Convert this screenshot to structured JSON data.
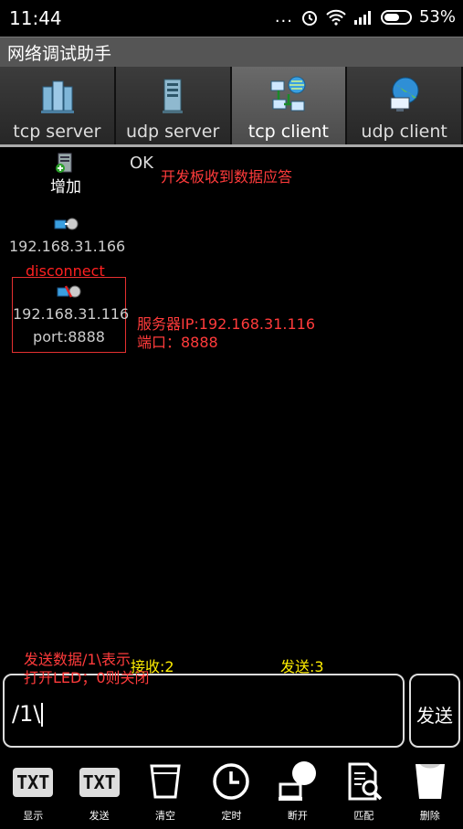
{
  "status": {
    "time": "11:44",
    "dots": "...",
    "battery": "53%"
  },
  "app_title": "网络调试助手",
  "tabs": [
    {
      "label": "tcp server",
      "active": false
    },
    {
      "label": "udp server",
      "active": false
    },
    {
      "label": "tcp client",
      "active": true
    },
    {
      "label": "udp client",
      "active": false
    }
  ],
  "main": {
    "add_label": "增加",
    "ok": "OK",
    "annotation_ack": "开发板收到数据应答",
    "conn1_ip": "192.168.31.166",
    "disconnect": "disconnect",
    "conn2_ip": "192.168.31.116",
    "conn2_port": "port:8888",
    "annotation_server_ip": "服务器IP:192.168.31.116",
    "annotation_port": "端口：8888",
    "annotation_send_line1": "发送数据/1\\表示",
    "annotation_send_line2": "打开LED；0则关闭",
    "recv_label": "接收:2",
    "sent_label": "发送:3",
    "input_value": "/1\\",
    "send_button": "发送"
  },
  "toolbar": {
    "txt": "TXT",
    "items": [
      {
        "label": "显示"
      },
      {
        "label": "发送"
      },
      {
        "label": "清空"
      },
      {
        "label": "定时"
      },
      {
        "label": "断开"
      },
      {
        "label": "匹配"
      },
      {
        "label": "删除"
      }
    ]
  }
}
